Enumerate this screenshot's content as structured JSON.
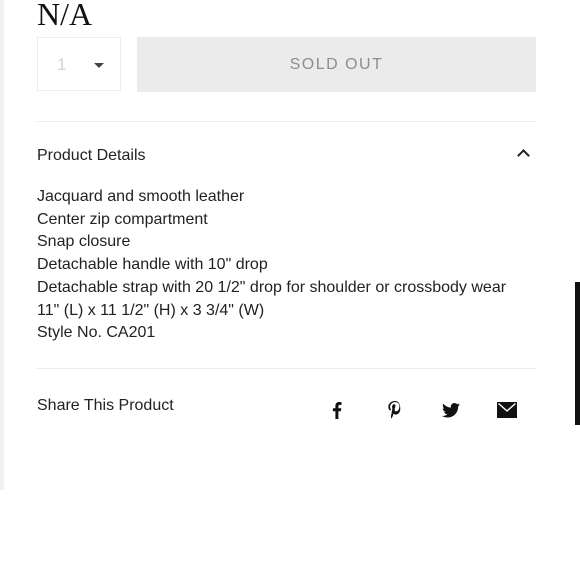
{
  "product": {
    "price": "N/A",
    "quantity": "1",
    "sold_out_label": "SOLD OUT"
  },
  "details": {
    "title": "Product Details",
    "items": [
      "Jacquard and smooth leather",
      "Center zip compartment",
      "Snap closure",
      "Detachable handle with 10\" drop",
      "Detachable strap with 20 1/2\" drop for shoulder or crossbody wear",
      "11\" (L) x 11 1/2\" (H) x 3 3/4\" (W)",
      "Style No. CA201"
    ]
  },
  "share": {
    "label": "Share This Product",
    "icons": [
      "facebook-icon",
      "pinterest-icon",
      "twitter-icon",
      "email-icon"
    ]
  },
  "colors": {
    "text": "#222222",
    "button_bg": "#ebebeb",
    "button_text": "#8e8e8e",
    "divider": "#ebebeb"
  }
}
